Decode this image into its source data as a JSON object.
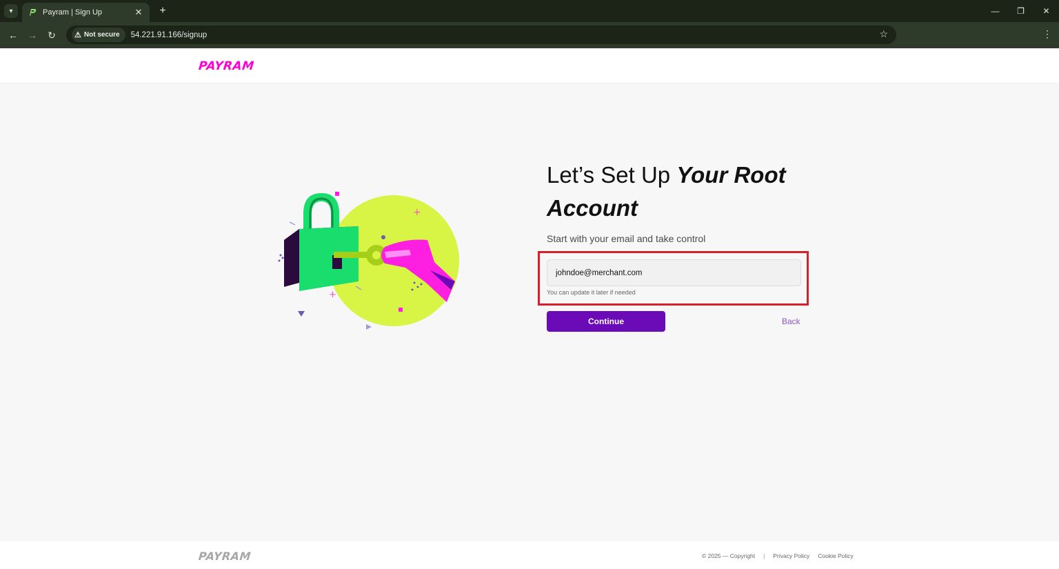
{
  "browser": {
    "tab_title": "Payram | Sign Up",
    "new_tab_symbol": "+",
    "security_label": "Not secure",
    "url": "54.221.91.166/signup",
    "window_controls": [
      "minimize-icon",
      "restore-icon",
      "close-icon"
    ]
  },
  "header": {
    "logo_text": "PAYRAM"
  },
  "signup": {
    "title_plain": "Let’s Set Up ",
    "title_emphasis": "Your Root Account",
    "subtitle": "Start with your email and take control",
    "email_value": "johndoe@merchant.com",
    "helper_text": "You can update it later if needed",
    "continue_label": "Continue",
    "back_label": "Back"
  },
  "footer": {
    "logo_text": "PAYRAM",
    "copyright": "© 2025 — Copyright",
    "separator": "|",
    "privacy_label": "Privacy Policy",
    "cookie_label": "Cookie Policy"
  },
  "colors": {
    "brand_magenta": "#ff00d4",
    "primary_purple": "#6b0bb7",
    "highlight_red": "#d9202a",
    "lime": "#d8f545",
    "lock_green": "#19dd6c"
  }
}
